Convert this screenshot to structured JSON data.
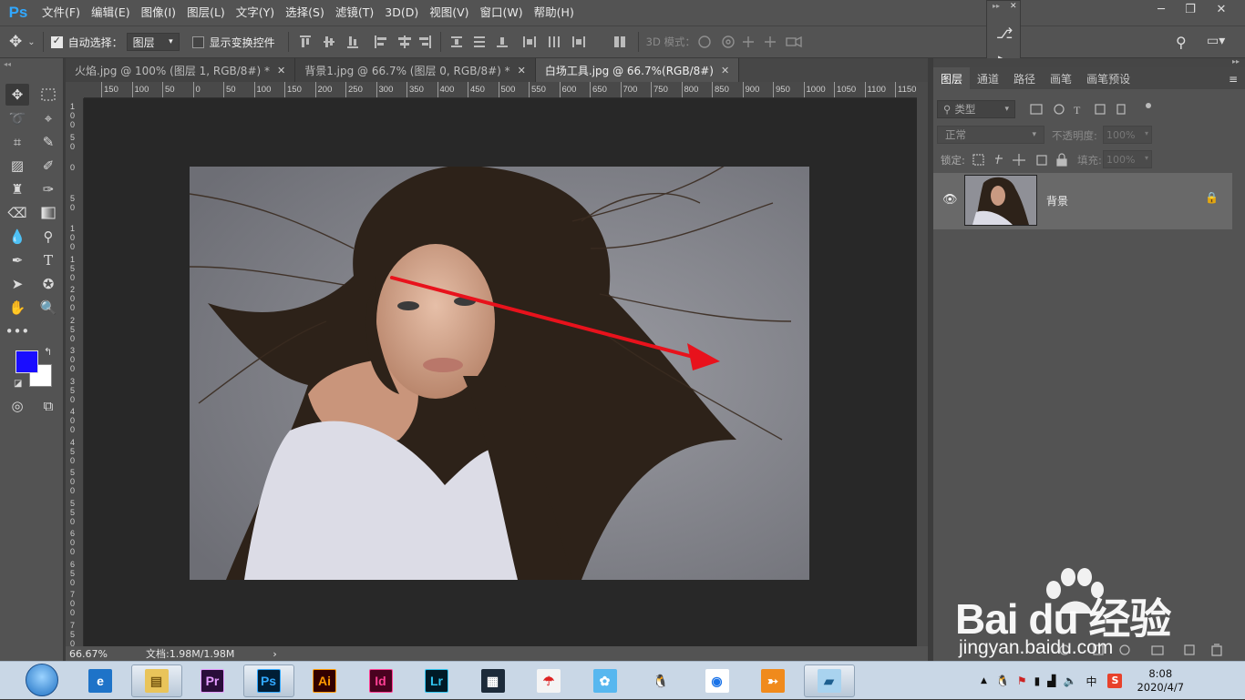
{
  "app": {
    "logo": "Ps"
  },
  "menu": [
    "文件(F)",
    "编辑(E)",
    "图像(I)",
    "图层(L)",
    "文字(Y)",
    "选择(S)",
    "滤镜(T)",
    "3D(D)",
    "视图(V)",
    "窗口(W)",
    "帮助(H)"
  ],
  "window_controls": {
    "minimize": "─",
    "restore": "❐",
    "close": "✕"
  },
  "options_bar": {
    "auto_select_label": "自动选择：",
    "auto_select_checked": true,
    "auto_select_target": "图层",
    "show_transform_label": "显示变换控件",
    "show_transform_checked": false,
    "mode_3d_label": "3D 模式："
  },
  "tabs": [
    {
      "label": "火焰.jpg @ 100% (图层 1, RGB/8#) *",
      "active": false
    },
    {
      "label": "背景1.jpg @ 66.7% (图层 0, RGB/8#) *",
      "active": false
    },
    {
      "label": "白场工具.jpg @ 66.7%(RGB/8#)",
      "active": true
    }
  ],
  "ruler_top_labels": [
    "150",
    "100",
    "50",
    "0",
    "50",
    "100",
    "150",
    "200",
    "250",
    "300",
    "350",
    "400",
    "450",
    "500",
    "550",
    "600",
    "650",
    "700",
    "750",
    "800",
    "850",
    "900",
    "950",
    "1000",
    "1050",
    "1100",
    "1150"
  ],
  "ruler_left_labels": [
    "100",
    "50",
    "0",
    "50",
    "100",
    "150",
    "200",
    "250",
    "300",
    "350",
    "400",
    "450",
    "500",
    "550",
    "600",
    "650",
    "700",
    "750"
  ],
  "status": {
    "zoom": "66.67%",
    "doc_info": "文档:1.98M/1.98M",
    "arrow": "›"
  },
  "colors": {
    "foreground": "#1a0dff",
    "background": "#ffffff",
    "arrow": "#e8121c",
    "panel": "#535353",
    "canvas": "#282828"
  },
  "mini_panel": {
    "collapse": "▸▸",
    "close": "✕"
  },
  "layers_panel": {
    "tabs": [
      "图层",
      "通道",
      "路径",
      "画笔",
      "画笔预设"
    ],
    "filter_label": "类型",
    "blend_mode": "正常",
    "opacity_label": "不透明度:",
    "opacity_value": "100%",
    "lock_label": "锁定:",
    "fill_label": "填充:",
    "fill_value": "100%",
    "layers": [
      {
        "name": "背景",
        "visible": true,
        "locked": true
      }
    ]
  },
  "watermark": {
    "brand": "Bai du 经验",
    "url": "jingyan.baidu.com"
  },
  "taskbar": {
    "apps": [
      {
        "name": "ie",
        "label": ""
      },
      {
        "name": "explorer",
        "label": ""
      },
      {
        "name": "premiere",
        "label": "Pr"
      },
      {
        "name": "photoshop",
        "label": "Ps"
      },
      {
        "name": "illustrator",
        "label": "Ai"
      },
      {
        "name": "indesign",
        "label": "Id"
      },
      {
        "name": "lightroom",
        "label": "Lr"
      },
      {
        "name": "video",
        "label": ""
      },
      {
        "name": "umbrella",
        "label": ""
      },
      {
        "name": "bird",
        "label": ""
      },
      {
        "name": "qq",
        "label": ""
      },
      {
        "name": "chrome",
        "label": ""
      },
      {
        "name": "orange",
        "label": ""
      },
      {
        "name": "note",
        "label": ""
      }
    ],
    "tray": {
      "ime": "中",
      "time": "8:08",
      "date": "2020/4/7"
    }
  }
}
